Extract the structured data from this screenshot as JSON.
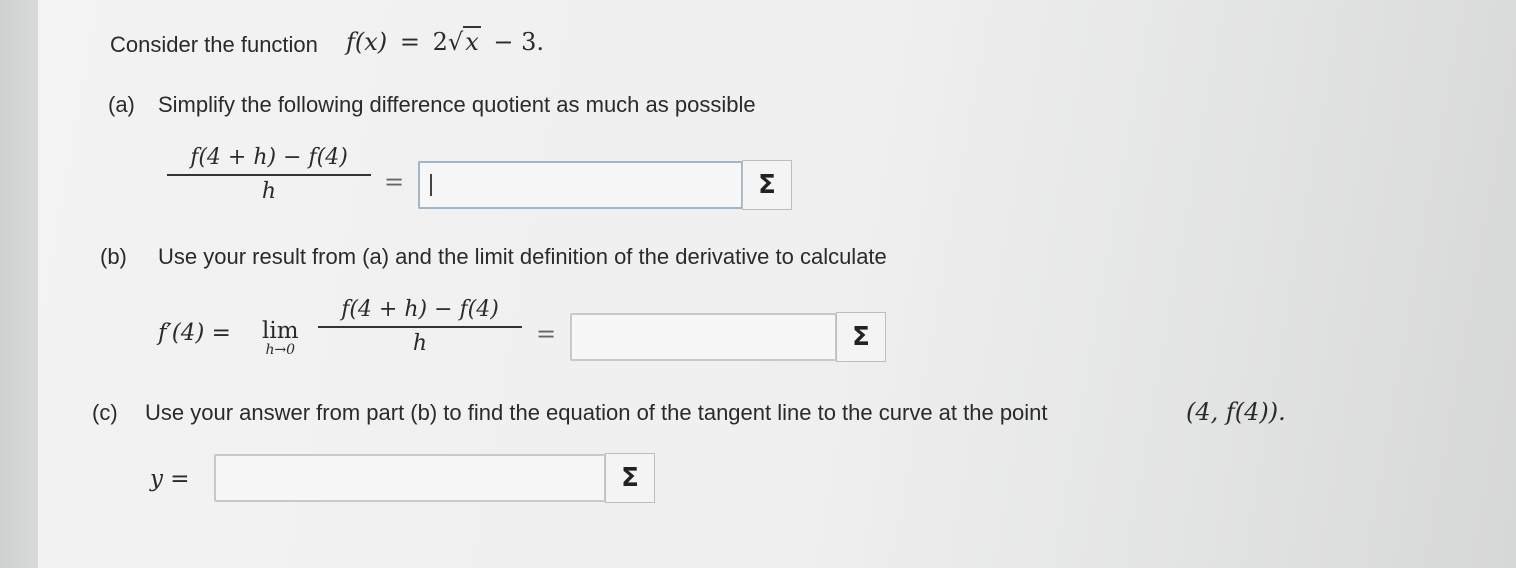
{
  "intro": {
    "text": "Consider the function",
    "function_expr": "f(x) = 2√x − 3",
    "fx_lhs": "f(x)",
    "eq": "=",
    "coef": "2",
    "radicand": "x",
    "tail": "− 3."
  },
  "part_a": {
    "label": "(a)",
    "prompt": "Simplify the following difference quotient as much as possible",
    "numerator": "f(4 + h) − f(4)",
    "denominator": "h",
    "eq": "=",
    "answer_value": "",
    "sigma_label": "Σ"
  },
  "part_b": {
    "label": "(b)",
    "prompt_prefix": "Use your result from (a) and the limit definition of the derivative to calculate",
    "lhs": "f′(4) =",
    "lim": "lim",
    "lim_sub": "h→0",
    "numerator": "f(4 + h) − f(4)",
    "denominator": "h",
    "eq": "=",
    "answer_value": "",
    "sigma_label": "Σ"
  },
  "part_c": {
    "label": "(c)",
    "prompt": "Use your answer from part (b) to find the equation of the tangent line to the curve at the point",
    "point": "(4, f(4)).",
    "lhs": "y =",
    "answer_value": "",
    "sigma_label": "Σ"
  }
}
